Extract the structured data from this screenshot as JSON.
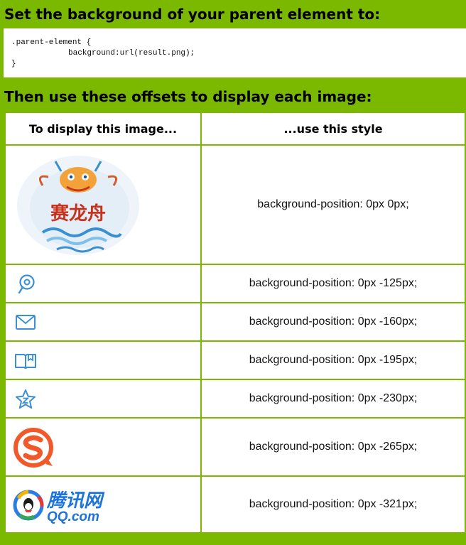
{
  "header1": "Set the background of your parent element to:",
  "code": {
    "line1": ".parent-element {",
    "line2": "background:url(result.png);",
    "line3": "}"
  },
  "header2": "Then use these offsets to display each image:",
  "table": {
    "col1": "To display this image...",
    "col2": "...use this style",
    "rows": [
      {
        "style": "background-position: 0px 0px;",
        "icon": "dragon-boat-logo"
      },
      {
        "style": "background-position: 0px -125px;",
        "icon": "map-pin-icon"
      },
      {
        "style": "background-position: 0px -160px;",
        "icon": "mail-icon"
      },
      {
        "style": "background-position: 0px -195px;",
        "icon": "book-icon"
      },
      {
        "style": "background-position: 0px -230px;",
        "icon": "star-icon"
      },
      {
        "style": "background-position: 0px -265px;",
        "icon": "sogou-logo"
      },
      {
        "style": "background-position: 0px -321px;",
        "icon": "qq-logo"
      }
    ]
  },
  "logos": {
    "dragon_text": "赛龙舟",
    "qq_brand": "腾讯网",
    "qq_domain": "QQ.com"
  },
  "colors": {
    "background": "#7ab900",
    "icon_blue": "#3b8fd4",
    "sogou_orange": "#f05a2a"
  }
}
